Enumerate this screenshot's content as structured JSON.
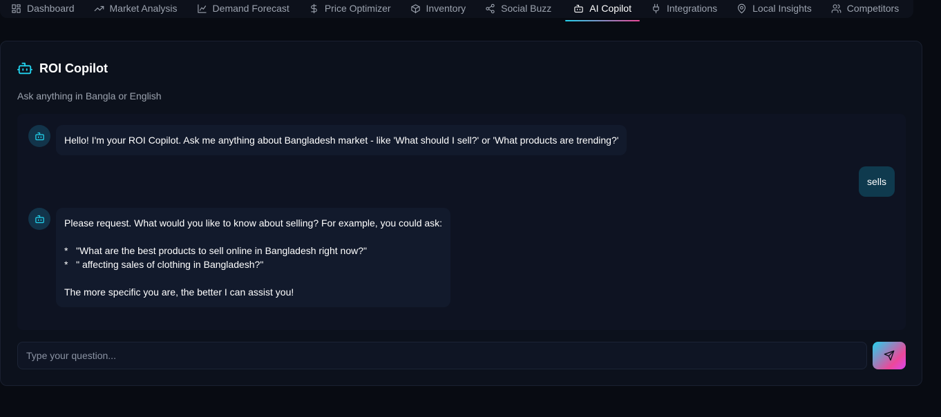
{
  "nav": {
    "items": [
      {
        "label": "Dashboard",
        "icon": "grid-icon",
        "active": false
      },
      {
        "label": "Market Analysis",
        "icon": "trending-up-icon",
        "active": false
      },
      {
        "label": "Demand Forecast",
        "icon": "line-chart-icon",
        "active": false
      },
      {
        "label": "Price Optimizer",
        "icon": "dollar-icon",
        "active": false
      },
      {
        "label": "Inventory",
        "icon": "box-icon",
        "active": false
      },
      {
        "label": "Social Buzz",
        "icon": "share-icon",
        "active": false
      },
      {
        "label": "AI Copilot",
        "icon": "bot-icon",
        "active": true
      },
      {
        "label": "Integrations",
        "icon": "plug-icon",
        "active": false
      },
      {
        "label": "Local Insights",
        "icon": "map-pin-icon",
        "active": false
      },
      {
        "label": "Competitors",
        "icon": "users-icon",
        "active": false
      }
    ],
    "active_underline": [
      "#22d3ee",
      "#ec4899"
    ]
  },
  "copilot": {
    "title": "ROI Copilot",
    "subtitle": "Ask anything in Bangla or English",
    "accent": "#22d3ee"
  },
  "messages": [
    {
      "role": "bot",
      "lines": [
        "Hello! I'm your ROI Copilot. Ask me anything about Bangladesh market - like 'What should I sell?' or 'What products are trending?'"
      ]
    },
    {
      "role": "user",
      "lines": [
        "sells"
      ]
    },
    {
      "role": "bot",
      "lines": [
        "Please request. What would you like to know about selling? For example, you could ask:",
        "",
        "*   \"What are the best products to sell online in Bangladesh right now?\"",
        "*   \" affecting sales of clothing in Bangladesh?\"",
        "",
        "The more specific you are, the better I can assist you!"
      ]
    }
  ],
  "input": {
    "value": "",
    "placeholder": "Type your question..."
  },
  "send_button": {
    "icon": "send-icon",
    "gradient": [
      "#22d3ee",
      "#ec4899"
    ]
  }
}
